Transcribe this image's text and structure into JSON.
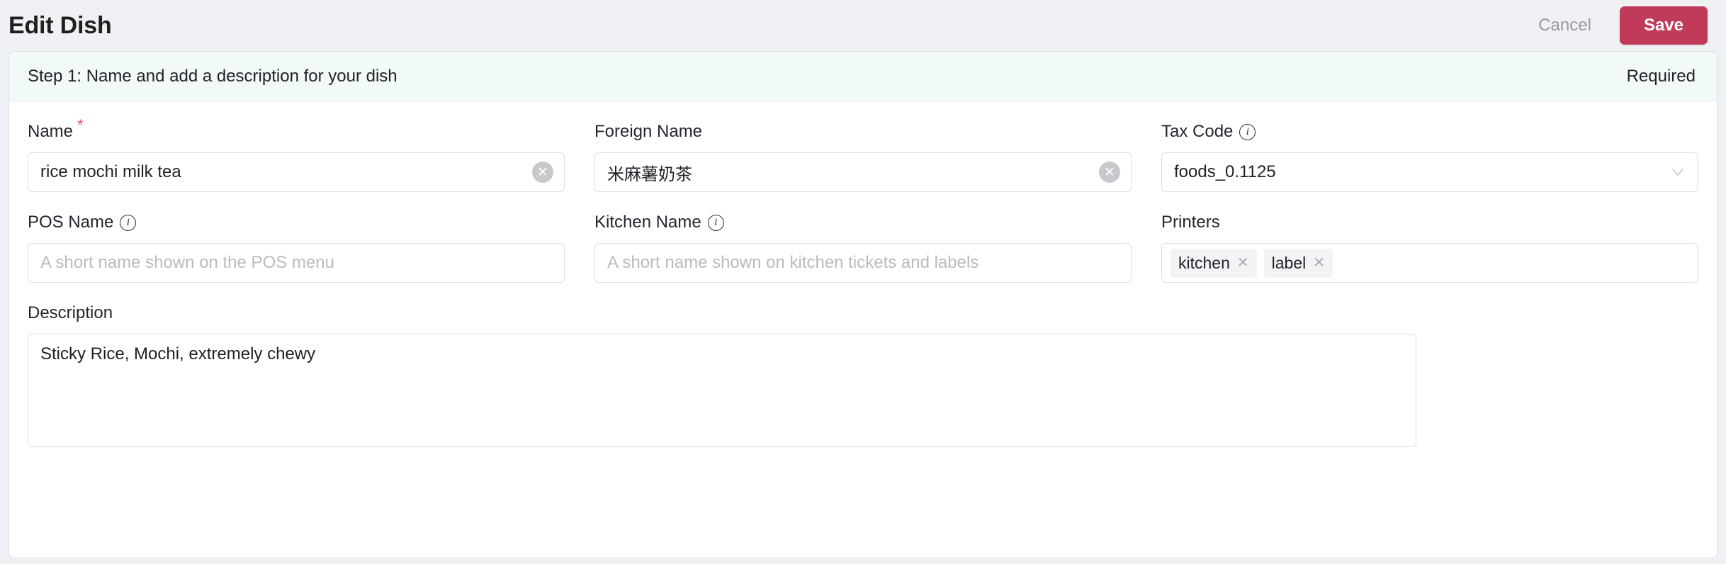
{
  "header": {
    "title": "Edit Dish",
    "cancel_label": "Cancel",
    "save_label": "Save",
    "save_color": "#c13a59"
  },
  "step_banner": {
    "text": "Step 1: Name and add a description for your dish",
    "required_label": "Required",
    "background": "#f1faf6"
  },
  "fields": {
    "name": {
      "label": "Name",
      "required_marker": "*",
      "value": "rice mochi milk tea",
      "clear_icon": "clear-circle-icon",
      "clear_glyph": "✕"
    },
    "foreign_name": {
      "label": "Foreign Name",
      "value": "米麻薯奶茶",
      "clear_glyph": "✕"
    },
    "tax_code": {
      "label": "Tax Code",
      "info_icon": "info-icon",
      "info_glyph": "i",
      "value": "foods_0.1125"
    },
    "pos_name": {
      "label": "POS Name",
      "info_glyph": "i",
      "value": "",
      "placeholder": "A short name shown on the POS menu"
    },
    "kitchen_name": {
      "label": "Kitchen Name",
      "info_glyph": "i",
      "value": "",
      "placeholder": "A short name shown on kitchen tickets and labels"
    },
    "printers": {
      "label": "Printers",
      "tags": [
        {
          "label": "kitchen",
          "remove_glyph": "✕"
        },
        {
          "label": "label",
          "remove_glyph": "✕"
        }
      ]
    },
    "description": {
      "label": "Description",
      "value": "Sticky Rice, Mochi, extremely chewy",
      "placeholder": ""
    }
  }
}
